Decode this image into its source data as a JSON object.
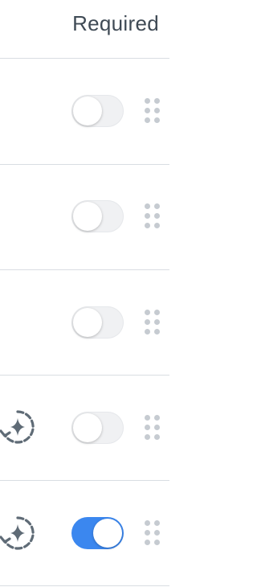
{
  "header": {
    "required_label": "Required"
  },
  "rows": [
    {
      "has_ai_icon": false,
      "required": false,
      "toggle_icon": "toggle-off"
    },
    {
      "has_ai_icon": false,
      "required": false,
      "toggle_icon": "toggle-off"
    },
    {
      "has_ai_icon": false,
      "required": false,
      "toggle_icon": "toggle-off"
    },
    {
      "has_ai_icon": true,
      "ai_icon": "ai-sparkle-refresh-icon",
      "required": false,
      "toggle_icon": "toggle-off"
    },
    {
      "has_ai_icon": true,
      "ai_icon": "ai-sparkle-refresh-icon",
      "required": true,
      "toggle_icon": "toggle-on"
    }
  ],
  "icons": {
    "drag_handle": "drag-handle-icon"
  },
  "colors": {
    "toggle_on": "#3b87ef",
    "toggle_off": "#f0f1f3",
    "header_text": "#3f4a55",
    "drag_dots": "#c6cbd1",
    "ai_icon": "#5f6b76",
    "divider": "#d9dde2"
  }
}
